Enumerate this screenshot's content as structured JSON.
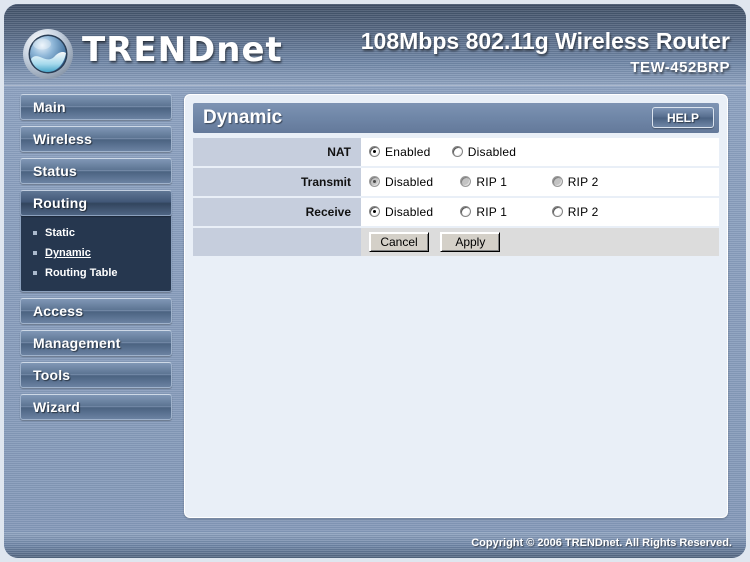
{
  "header": {
    "brand": "TRENDnet",
    "brand_main": "TREND",
    "brand_suffix": "net",
    "product_title": "108Mbps 802.11g Wireless Router",
    "model": "TEW-452BRP",
    "logo_icon": "trendnet-globe-icon"
  },
  "sidebar": {
    "items": [
      {
        "label": "Main",
        "active": false
      },
      {
        "label": "Wireless",
        "active": false
      },
      {
        "label": "Status",
        "active": false
      },
      {
        "label": "Routing",
        "active": true
      },
      {
        "label": "Access",
        "active": false
      },
      {
        "label": "Management",
        "active": false
      },
      {
        "label": "Tools",
        "active": false
      },
      {
        "label": "Wizard",
        "active": false
      }
    ],
    "submenu": {
      "parent": "Routing",
      "items": [
        {
          "label": "Static",
          "current": false
        },
        {
          "label": "Dynamic",
          "current": true
        },
        {
          "label": "Routing Table",
          "current": false
        }
      ]
    }
  },
  "panel": {
    "title": "Dynamic",
    "help_label": "HELP",
    "rows": [
      {
        "label": "NAT",
        "options": [
          {
            "text": "Enabled",
            "selected": true,
            "dimmed": false
          },
          {
            "text": "Disabled",
            "selected": false,
            "dimmed": false
          }
        ]
      },
      {
        "label": "Transmit",
        "options": [
          {
            "text": "Disabled",
            "selected": true,
            "dimmed": true
          },
          {
            "text": "RIP 1",
            "selected": false,
            "dimmed": true
          },
          {
            "text": "RIP 2",
            "selected": false,
            "dimmed": true
          }
        ]
      },
      {
        "label": "Receive",
        "options": [
          {
            "text": "Disabled",
            "selected": true,
            "dimmed": false
          },
          {
            "text": "RIP 1",
            "selected": false,
            "dimmed": false
          },
          {
            "text": "RIP 2",
            "selected": false,
            "dimmed": false
          }
        ]
      }
    ],
    "buttons": {
      "cancel_label": "Cancel",
      "apply_label": "Apply"
    }
  },
  "footer": {
    "copyright": "Copyright © 2006 TRENDnet. All Rights Reserved."
  },
  "colors": {
    "header_dark": "#3f4f66",
    "header_light": "#8fa3c0",
    "body_blue": "#8ba0bf",
    "panel_bg": "#e9eff7",
    "row_label_bg": "#c6cedd",
    "submenu_bg": "#26374f",
    "title_bar": "#6f86a7"
  }
}
